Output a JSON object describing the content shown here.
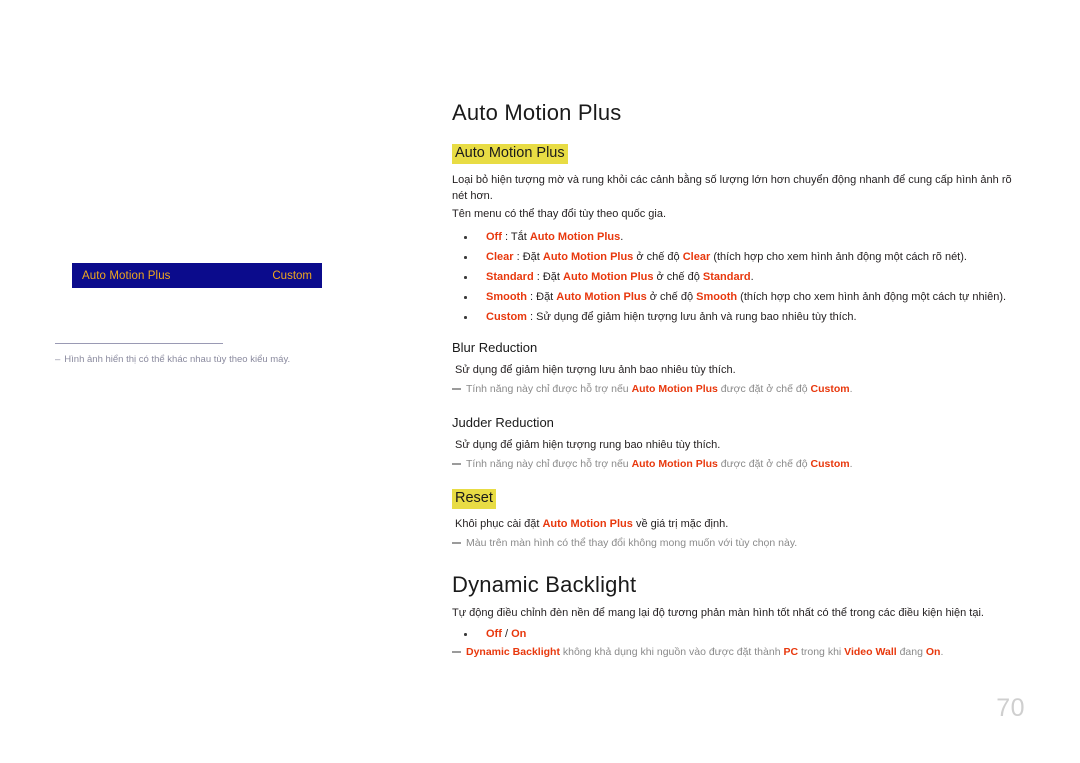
{
  "page": {
    "number": "70"
  },
  "osd_preview": {
    "menu_label": "Auto Motion Plus",
    "menu_value": "Custom",
    "note_dash": "‒",
    "note_text": "Hình ảnh hiển thị có thể khác nhau tùy theo kiểu máy."
  },
  "sections": {
    "auto_motion_plus": {
      "heading": "Auto Motion Plus",
      "sub_heading": "Auto Motion Plus",
      "paragraph_1": "Loại bỏ hiện tượng mờ và rung khỏi các cảnh bằng số lượng lớn hơn chuyển động nhanh để cung cấp hình ảnh rõ nét hơn.",
      "paragraph_2": "Tên menu có thể thay đổi tùy theo quốc gia.",
      "options": [
        {
          "term": "Off",
          "parts": [
            {
              "text": " : Tắt ",
              "style": "black"
            },
            {
              "text": "Auto Motion Plus",
              "style": "red"
            },
            {
              "text": ".",
              "style": "black"
            }
          ]
        },
        {
          "term": "Clear",
          "parts": [
            {
              "text": " : Đặt ",
              "style": "black"
            },
            {
              "text": "Auto Motion Plus",
              "style": "red"
            },
            {
              "text": " ở chế độ ",
              "style": "black"
            },
            {
              "text": "Clear",
              "style": "red"
            },
            {
              "text": " (thích hợp cho xem hình ảnh động một cách rõ nét).",
              "style": "black"
            }
          ]
        },
        {
          "term": "Standard",
          "parts": [
            {
              "text": " : Đặt ",
              "style": "black"
            },
            {
              "text": "Auto Motion Plus",
              "style": "red"
            },
            {
              "text": " ở chế độ ",
              "style": "black"
            },
            {
              "text": "Standard",
              "style": "red"
            },
            {
              "text": ".",
              "style": "black"
            }
          ]
        },
        {
          "term": "Smooth",
          "parts": [
            {
              "text": " : Đặt ",
              "style": "black"
            },
            {
              "text": "Auto Motion Plus",
              "style": "red"
            },
            {
              "text": " ở chế độ ",
              "style": "black"
            },
            {
              "text": "Smooth",
              "style": "red"
            },
            {
              "text": " (thích hợp cho xem hình ảnh động một cách tự nhiên).",
              "style": "black"
            }
          ]
        },
        {
          "term": "Custom",
          "parts": [
            {
              "text": " : Sử dụng để giảm hiện tượng lưu ảnh và rung bao nhiêu tùy thích.",
              "style": "black"
            }
          ]
        }
      ]
    },
    "blur_reduction": {
      "heading": "Blur Reduction",
      "paragraph": "Sử dụng để giảm hiện tượng lưu ảnh bao nhiêu tùy thích.",
      "note_parts": [
        {
          "text": "Tính năng này chỉ được hỗ trợ nếu ",
          "style": "grey"
        },
        {
          "text": "Auto Motion Plus",
          "style": "red"
        },
        {
          "text": " được đặt ở chế độ ",
          "style": "grey"
        },
        {
          "text": "Custom",
          "style": "red"
        },
        {
          "text": ".",
          "style": "grey"
        }
      ]
    },
    "judder_reduction": {
      "heading": "Judder Reduction",
      "paragraph": "Sử dụng để giảm hiện tượng rung bao nhiêu tùy thích.",
      "note_parts": [
        {
          "text": "Tính năng này chỉ được hỗ trợ nếu ",
          "style": "grey"
        },
        {
          "text": "Auto Motion Plus",
          "style": "red"
        },
        {
          "text": " được đặt ở chế độ ",
          "style": "grey"
        },
        {
          "text": "Custom",
          "style": "red"
        },
        {
          "text": ".",
          "style": "grey"
        }
      ]
    },
    "reset": {
      "sub_heading": "Reset",
      "paragraph_parts": [
        {
          "text": "Khôi phục cài đặt ",
          "style": "black"
        },
        {
          "text": "Auto Motion Plus",
          "style": "red"
        },
        {
          "text": " về giá trị mặc định.",
          "style": "black"
        }
      ],
      "note_parts": [
        {
          "text": "Màu trên màn hình có thể thay đổi không mong muốn với tùy chọn này.",
          "style": "grey"
        }
      ]
    },
    "dynamic_backlight": {
      "heading": "Dynamic Backlight",
      "paragraph": "Tự động điều chỉnh đèn nền để mang lại độ tương phản màn hình tốt nhất có thể trong các điều kiện hiện tại.",
      "options": [
        {
          "term": "",
          "parts": [
            {
              "text": "Off",
              "style": "red"
            },
            {
              "text": " / ",
              "style": "black"
            },
            {
              "text": "On",
              "style": "red"
            }
          ]
        }
      ],
      "note_parts": [
        {
          "text": "Dynamic Backlight",
          "style": "red"
        },
        {
          "text": " không khả dụng khi nguồn vào được đặt thành ",
          "style": "grey"
        },
        {
          "text": "PC",
          "style": "red"
        },
        {
          "text": " trong khi ",
          "style": "grey"
        },
        {
          "text": "Video Wall",
          "style": "red"
        },
        {
          "text": " đang ",
          "style": "grey"
        },
        {
          "text": "On",
          "style": "red"
        },
        {
          "text": ".",
          "style": "grey"
        }
      ]
    }
  },
  "colors": {
    "accent_red": "#e8380d",
    "highlight_yellow": "#e8dc44",
    "osd_blue": "#0b0b8c",
    "osd_amber": "#f0a81e"
  }
}
